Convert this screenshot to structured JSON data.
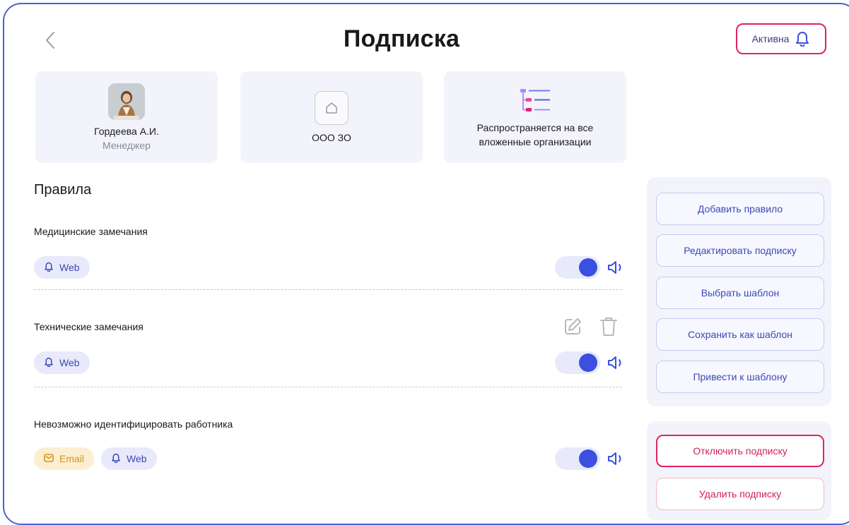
{
  "header": {
    "title": "Подписка",
    "status_label": "Активна"
  },
  "cards": {
    "user": {
      "name": "Гордеева А.И.",
      "role": "Менеджер"
    },
    "org": {
      "name": "ООО ЗО"
    },
    "scope": {
      "text_line1": "Распространяется на все",
      "text_line2": "вложенные организации"
    }
  },
  "rules": {
    "title": "Правила",
    "items": [
      {
        "name": "Медицинские замечания",
        "channels": [
          "Web"
        ],
        "enabled": true
      },
      {
        "name": "Технические замечания",
        "channels": [
          "Web"
        ],
        "enabled": true
      },
      {
        "name": "Невозможно идентифицировать работника",
        "channels": [
          "Email",
          "Web"
        ],
        "enabled": true
      }
    ]
  },
  "actions": {
    "add_rule": "Добавить правило",
    "edit_subscription": "Редактировать подписку",
    "choose_template": "Выбрать шаблон",
    "save_as_template": "Сохранить как шаблон",
    "apply_template": "Привести к шаблону",
    "disable_subscription": "Отключить подписку",
    "delete_subscription": "Удалить подписку"
  },
  "colors": {
    "accent": "#3b4fe0",
    "danger": "#e0245e",
    "frame": "#4d5fd6",
    "panel_bg": "#f3f4fb"
  },
  "icons": [
    "back-chevron-icon",
    "bell-icon",
    "home-icon",
    "hierarchy-icon",
    "edit-icon",
    "trash-icon",
    "sound-icon",
    "mail-icon"
  ]
}
